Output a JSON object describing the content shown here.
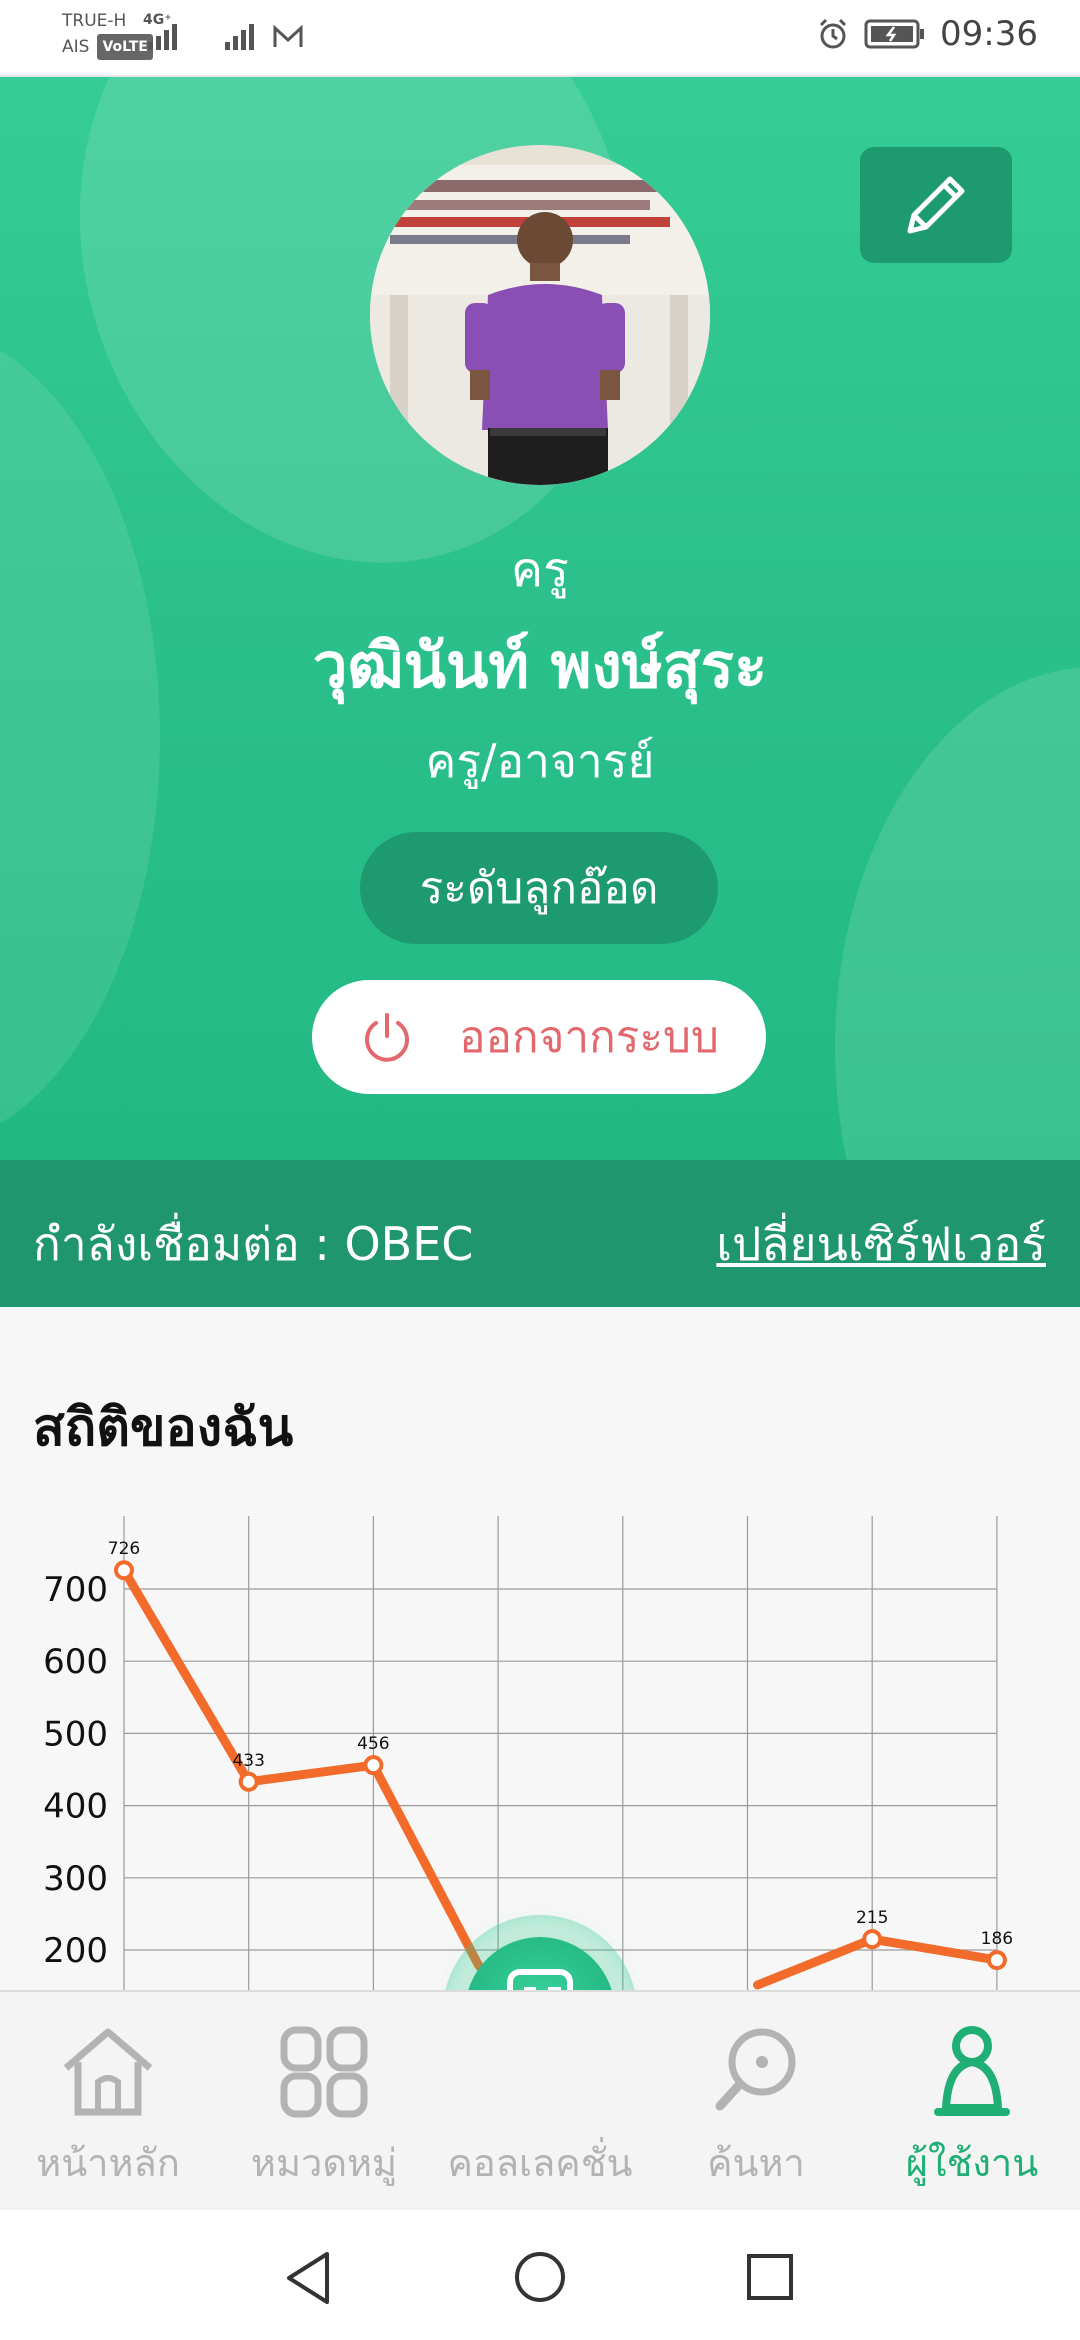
{
  "status_bar": {
    "carrier_1": "TRUE-H",
    "carrier_2": "AIS",
    "volte": "VoLTE",
    "network": "4G⁺",
    "time": "09:36"
  },
  "profile": {
    "role": "ครู",
    "name": "วุฒินันท์ พงษ์สุระ",
    "position": "ครู/อาจารย์",
    "level": "ระดับลูกอ๊อด",
    "logout_label": "ออกจากระบบ",
    "server_label": "กำลังเชื่อมต่อ : OBEC",
    "change_server": "เปลี่ยนเซิร์ฟเวอร์"
  },
  "stats": {
    "title": "สถิติของฉัน"
  },
  "chart_data": {
    "type": "line",
    "title": "",
    "x": [
      1,
      2,
      3,
      4,
      5,
      6,
      7,
      8
    ],
    "values": [
      726,
      433,
      456,
      null,
      null,
      null,
      215,
      186
    ],
    "data_labels": [
      "726",
      "433",
      "456",
      "215",
      "186"
    ],
    "yticks": [
      "700",
      "600",
      "500",
      "400",
      "300",
      "200"
    ],
    "ylim": [
      150,
      750
    ],
    "grid": true,
    "line_color": "#f26b2a"
  },
  "bottom_nav": {
    "items": [
      {
        "label": "หน้าหลัก",
        "icon": "home-icon"
      },
      {
        "label": "หมวดหมู่",
        "icon": "category-icon"
      },
      {
        "label": "คอลเลคชั่น",
        "icon": "collection-icon"
      },
      {
        "label": "ค้นหา",
        "icon": "search-icon"
      },
      {
        "label": "ผู้ใช้งาน",
        "icon": "user-icon"
      }
    ],
    "active_index": 4
  },
  "colors": {
    "primary": "#2bc08b",
    "dark_green": "#1e9a70",
    "logout_red": "#e2686d",
    "active_nav": "#1fae73"
  }
}
